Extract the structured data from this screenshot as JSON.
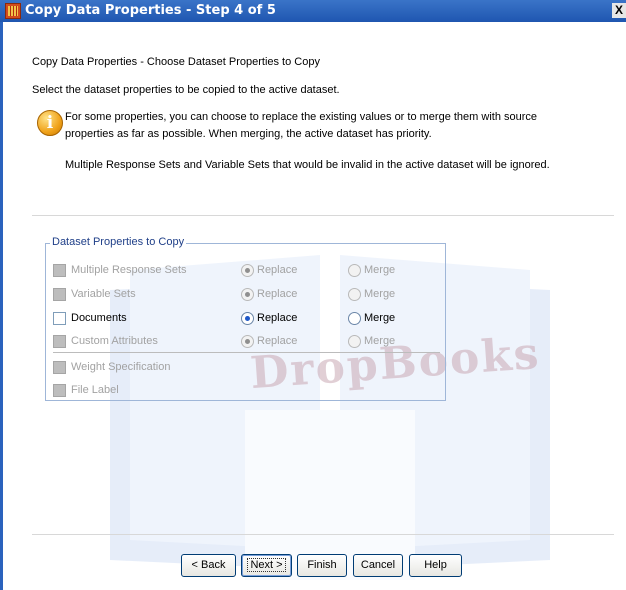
{
  "window": {
    "title": "Copy Data Properties - Step 4 of 5",
    "close_glyph": "X"
  },
  "content": {
    "heading": "Copy Data Properties - Choose Dataset Properties to Copy",
    "instruction": "Select the dataset properties to be copied to the active dataset.",
    "info_line1": "For some properties, you can choose to replace the existing values or to merge them with source",
    "info_line2": "properties as far as possible.  When merging, the active dataset has priority.",
    "info_line3": "Multiple Response Sets and Variable Sets that would be invalid in the active dataset will be ignored."
  },
  "group": {
    "label": "Dataset Properties to Copy",
    "rows": [
      {
        "label": "Multiple Response Sets",
        "checked": false,
        "enabled": false,
        "replace": "Replace",
        "merge": "Merge",
        "selected": "replace"
      },
      {
        "label": "Variable Sets",
        "checked": false,
        "enabled": false,
        "replace": "Replace",
        "merge": "Merge",
        "selected": "replace"
      },
      {
        "label": "Documents",
        "checked": false,
        "enabled": true,
        "replace": "Replace",
        "merge": "Merge",
        "selected": "replace"
      },
      {
        "label": "Custom Attributes",
        "checked": false,
        "enabled": false,
        "replace": "Replace",
        "merge": "Merge",
        "selected": "replace"
      }
    ],
    "extra": [
      {
        "label": "Weight Specification",
        "enabled": false
      },
      {
        "label": "File Label",
        "enabled": false
      }
    ]
  },
  "buttons": {
    "back": "< Back",
    "next": "Next >",
    "finish": "Finish",
    "cancel": "Cancel",
    "help": "Help"
  },
  "watermark": {
    "text": "DropBooks"
  },
  "colors": {
    "title_bar": "#2a62bd",
    "group_label": "#1f3f88",
    "disabled_text": "#a2a2a2",
    "radio_selected": "#1f58c8"
  }
}
